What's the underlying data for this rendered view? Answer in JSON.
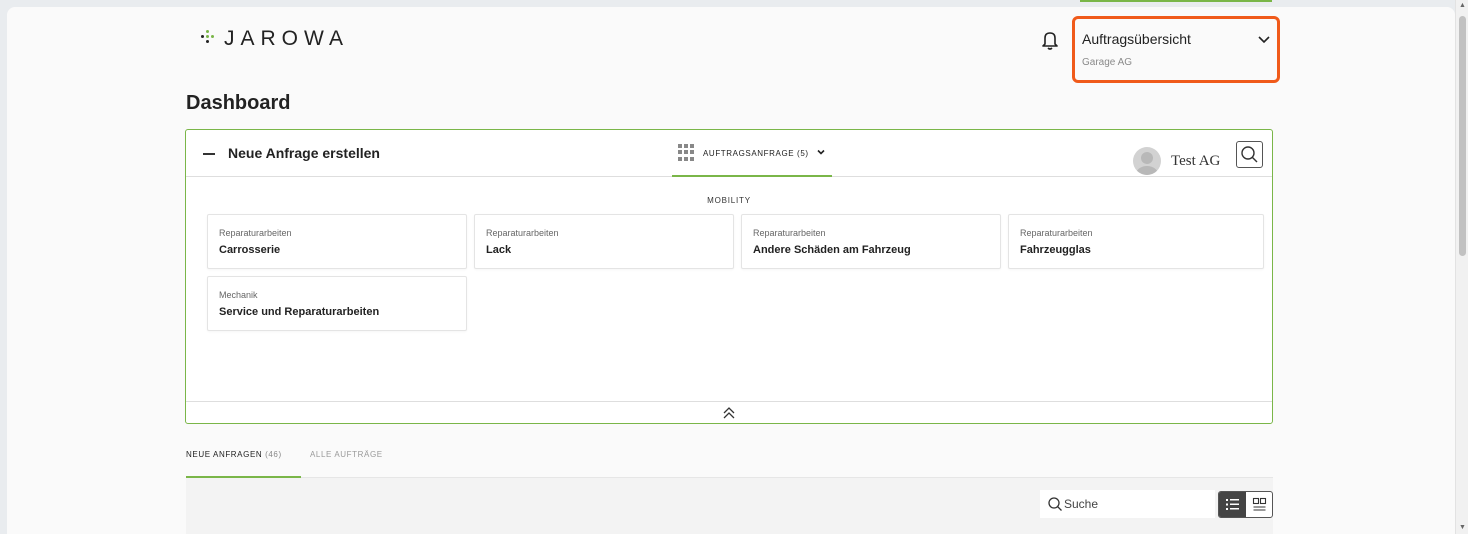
{
  "header": {
    "logo_text": "JAROWA",
    "account": {
      "title": "Auftragsübersicht",
      "subtitle": "Garage AG"
    }
  },
  "page": {
    "title": "Dashboard"
  },
  "panel": {
    "title": "Neue Anfrage erstellen",
    "request_tab_label": "AUFTRAGSANFRAGE (5)",
    "user_name": "Test AG",
    "section_label": "MOBILITY",
    "cards": [
      {
        "category": "Reparaturarbeiten",
        "title": "Carrosserie"
      },
      {
        "category": "Reparaturarbeiten",
        "title": "Lack"
      },
      {
        "category": "Reparaturarbeiten",
        "title": "Andere Schäden am Fahrzeug"
      },
      {
        "category": "Reparaturarbeiten",
        "title": "Fahrzeugglas"
      },
      {
        "category": "Mechanik",
        "title": "Service und Reparaturarbeiten"
      }
    ]
  },
  "tabs": {
    "new_requests_label": "NEUE ANFRAGEN",
    "new_requests_count": "(46)",
    "all_orders_label": "ALLE AUFTRÄGE"
  },
  "search": {
    "placeholder": "Suche"
  },
  "colors": {
    "accent": "#7ab648",
    "highlight": "#f05a1a"
  }
}
